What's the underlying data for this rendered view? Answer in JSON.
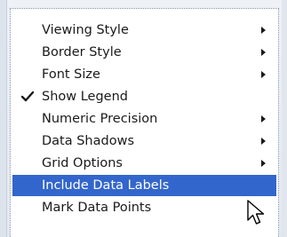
{
  "menu": {
    "items": [
      {
        "label": "Viewing Style",
        "checked": false,
        "submenu": true,
        "highlighted": false
      },
      {
        "label": "Border Style",
        "checked": false,
        "submenu": true,
        "highlighted": false
      },
      {
        "label": "Font Size",
        "checked": false,
        "submenu": true,
        "highlighted": false
      },
      {
        "label": "Show Legend",
        "checked": true,
        "submenu": false,
        "highlighted": false
      },
      {
        "label": "Numeric Precision",
        "checked": false,
        "submenu": true,
        "highlighted": false
      },
      {
        "label": "Data Shadows",
        "checked": false,
        "submenu": true,
        "highlighted": false
      },
      {
        "label": "Grid Options",
        "checked": false,
        "submenu": true,
        "highlighted": false
      },
      {
        "label": "Include Data Labels",
        "checked": false,
        "submenu": false,
        "highlighted": true
      },
      {
        "label": "Mark Data Points",
        "checked": false,
        "submenu": false,
        "highlighted": false
      }
    ]
  },
  "colors": {
    "highlight": "#3366cc",
    "text": "#1a1a1a",
    "highlight_text": "#ffffff"
  },
  "icons": {
    "check": "check-icon",
    "submenu": "chevron-right-icon",
    "cursor": "mouse-pointer-icon"
  }
}
